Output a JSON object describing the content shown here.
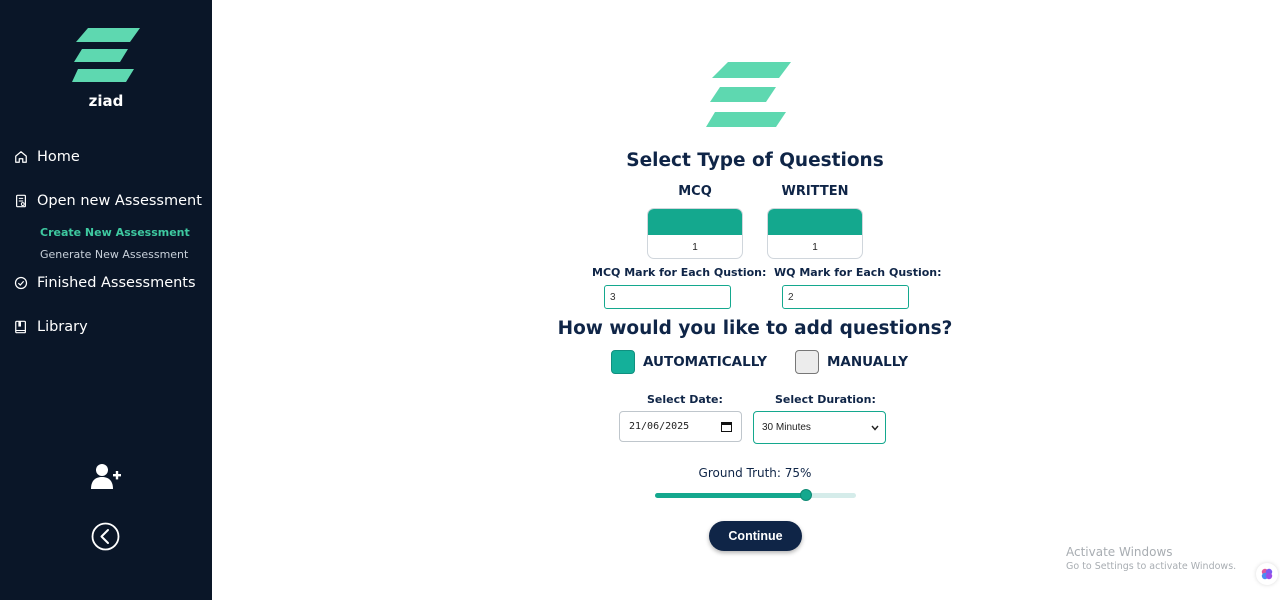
{
  "sidebar": {
    "brand": "ziad",
    "items": [
      {
        "label": "Home",
        "icon": "home-icon"
      },
      {
        "label": "Open new Assessment",
        "icon": "document-icon"
      },
      {
        "label": "Finished Assessments",
        "icon": "check-circle-icon"
      },
      {
        "label": "Library",
        "icon": "book-icon"
      }
    ],
    "subitems": [
      {
        "label": "Create New Assessment",
        "active": true
      },
      {
        "label": "Generate New Assessment",
        "active": false
      }
    ],
    "bottom_icons": [
      "add-user-icon",
      "back-arrow-icon"
    ]
  },
  "main": {
    "title": "Select Type of Questions",
    "mcq": {
      "label": "MCQ",
      "count": "1",
      "mark_label": "MCQ Mark for Each Qustion:",
      "mark_value": "3"
    },
    "written": {
      "label": "WRITTEN",
      "count": "1",
      "mark_label": "WQ Mark for Each Qustion:",
      "mark_value": "2"
    },
    "add_title": "How would you like to add questions?",
    "options": [
      {
        "label": "AUTOMATICALLY",
        "checked": true
      },
      {
        "label": "MANUALLY",
        "checked": false
      }
    ],
    "date_label": "Select Date:",
    "date_value": "21/06/2025",
    "duration_label": "Select Duration:",
    "duration_value": "30 Minutes",
    "ground_truth_label": "Ground Truth: 75%",
    "ground_truth_value": 0.75,
    "continue_label": "Continue"
  },
  "watermark": {
    "line1": "Activate Windows",
    "line2": "Go to Settings to activate Windows."
  },
  "colors": {
    "sidebar_bg": "#0a1628",
    "accent": "#14a88e",
    "logo": "#5ed8b0",
    "navy": "#0f2547"
  }
}
